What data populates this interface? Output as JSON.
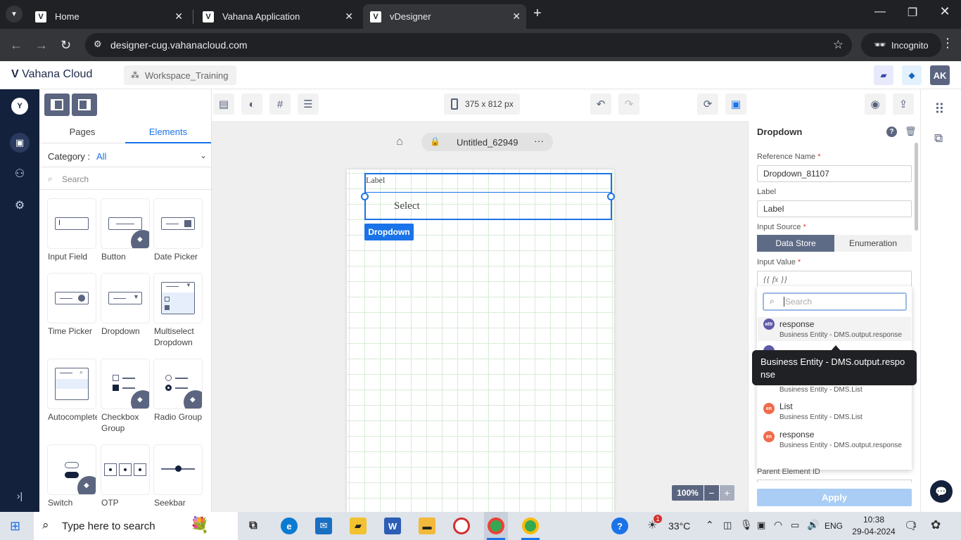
{
  "browser": {
    "tabs": [
      {
        "title": "Home"
      },
      {
        "title": "Vahana Application"
      },
      {
        "title": "vDesigner"
      }
    ],
    "url": "designer-cug.vahanacloud.com",
    "incognito_label": "Incognito"
  },
  "app": {
    "logo_text": "Vahana Cloud",
    "workspace": "Workspace_Training",
    "user_initials": "AK",
    "rail_avatar": "Y"
  },
  "left_panel": {
    "tabs": [
      "Pages",
      "Elements"
    ],
    "active_tab": "Elements",
    "category_label": "Category :",
    "category_value": "All",
    "search_placeholder": "Search",
    "elements": [
      {
        "label": "Input Field"
      },
      {
        "label": "Button"
      },
      {
        "label": "Date Picker"
      },
      {
        "label": "Time Picker"
      },
      {
        "label": "Dropdown"
      },
      {
        "label": "Multiselect Dropdown"
      },
      {
        "label": "Autocomplete"
      },
      {
        "label": "Checkbox Group"
      },
      {
        "label": "Radio Group"
      },
      {
        "label": "Switch"
      },
      {
        "label": "OTP"
      },
      {
        "label": "Seekbar"
      }
    ]
  },
  "toolbar": {
    "device_size": "375 x 812 px"
  },
  "canvas": {
    "page_name": "Untitled_62949",
    "more": "···",
    "field_label": "Label",
    "field_placeholder": "Select",
    "component_tag": "Dropdown",
    "zoom": "100%",
    "zoom_minus": "−",
    "zoom_plus": "+"
  },
  "properties": {
    "title": "Dropdown",
    "reference_name_label": "Reference Name",
    "reference_name_value": "Dropdown_81107",
    "label_label": "Label",
    "label_value": "Label",
    "input_source_label": "Input Source",
    "input_source_options": [
      "Data Store",
      "Enumeration"
    ],
    "input_source_selected": "Data Store",
    "input_value_label": "Input Value",
    "input_value_value": "{{ fx }}",
    "dropdown_search_placeholder": "Search",
    "dropdown_items": [
      {
        "badge": "attr",
        "name": "response",
        "source": "Business Entity - DMS.output.response"
      },
      {
        "badge": "",
        "name": "",
        "source": "Business Entity - DMS.List"
      },
      {
        "badge": "en",
        "name": "List",
        "source": "Business Entity - DMS.List"
      },
      {
        "badge": "en",
        "name": "response",
        "source": "Business Entity - DMS.output.response"
      }
    ],
    "tooltip": "Business Entity - DMS.output.response",
    "parent_element_label": "Parent Element ID",
    "apply_label": "Apply",
    "required_mark": "*"
  },
  "taskbar": {
    "search_placeholder": "Type here to search",
    "weather": "33°C",
    "language": "ENG",
    "time": "10:38",
    "date": "29-04-2024",
    "notification_count": "1",
    "weather_badge": "1"
  },
  "colors": {
    "accent": "#1a73e8",
    "rail": "#14213d",
    "segment_active": "#5e6b86",
    "apply_disabled": "#a9cdf5"
  }
}
